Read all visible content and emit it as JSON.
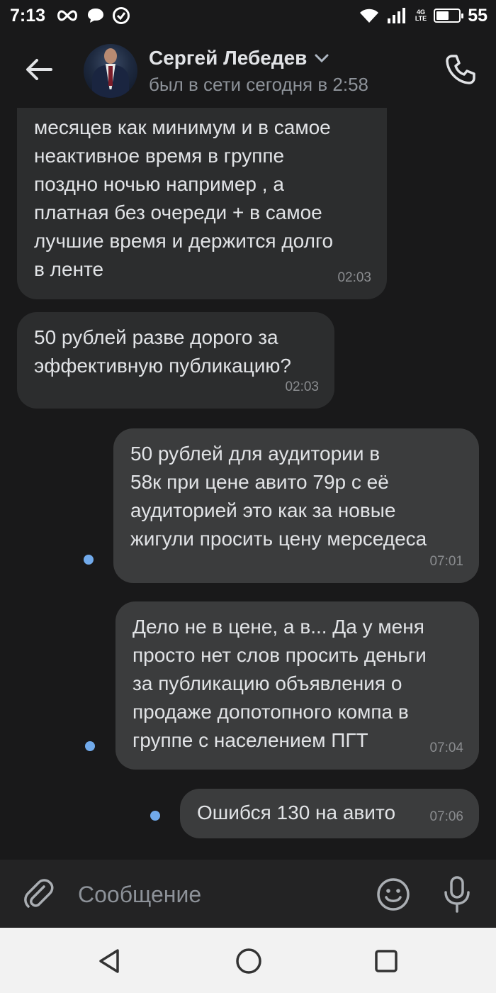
{
  "status_bar": {
    "time": "7:13",
    "network": "4G\nLTE",
    "battery": "55",
    "icons": [
      "infinity-icon",
      "chat-bubble-icon",
      "check-circle-icon",
      "wifi-icon",
      "cellular-signal-icon",
      "battery-icon"
    ]
  },
  "header": {
    "contact_name": "Сергей Лебедев",
    "status": "был в сети сегодня в 2:58"
  },
  "messages": [
    {
      "direction": "incoming",
      "text": "месяцев как минимум и в самое\nнеактивное время в группе\nпоздно ночью например , а\nплатная без очереди + в самое\nлучшие время и держится долго\nв ленте",
      "time": "02:03",
      "unread": false
    },
    {
      "direction": "incoming",
      "text": "50 рублей разве дорого за\nэффективную публикацию?",
      "time": "02:03",
      "unread": false
    },
    {
      "direction": "outgoing",
      "text": "50 рублей для аудитории в\n58к при цене авито 79р с её\nаудиторией это как за новые\nжигули просить цену мерседеса",
      "time": "07:01",
      "unread": true
    },
    {
      "direction": "outgoing",
      "text": "Дело не в цене, а в...  Да у меня\nпросто нет слов просить деньги\nза публикацию объявления о\nпродаже допотопного компа в\nгруппе с населением ПГТ",
      "time": "07:04",
      "unread": true
    },
    {
      "direction": "outgoing",
      "text": "Ошибся 130 на авито",
      "time": "07:06",
      "unread": true
    }
  ],
  "composer": {
    "placeholder": "Сообщение"
  },
  "colors": {
    "background": "#19191a",
    "bubble_incoming": "#2c2d2e",
    "bubble_outgoing": "#3b3c3d",
    "unread_dot": "#71aaeb",
    "nav_bar": "#f2f2f2"
  }
}
